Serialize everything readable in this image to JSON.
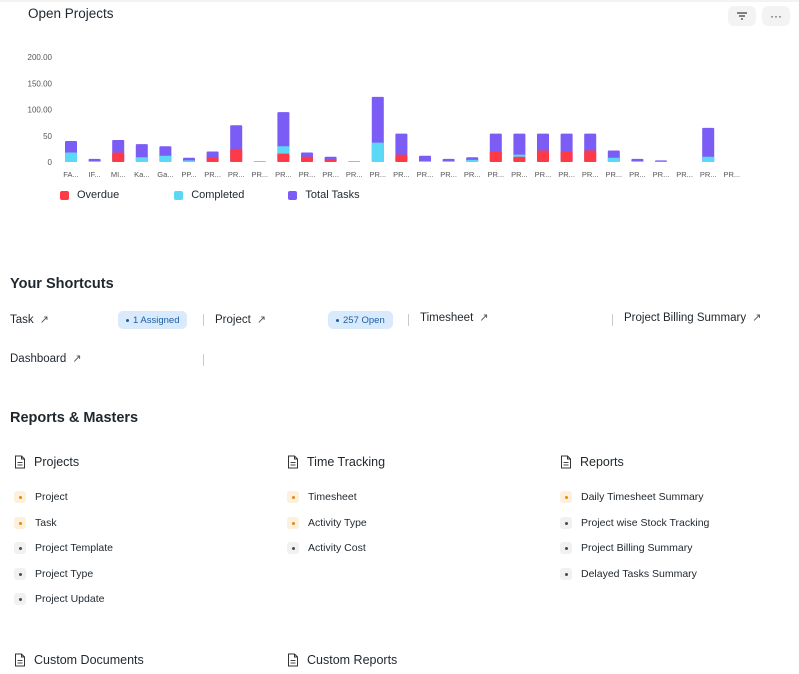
{
  "header": {
    "title": "Open Projects",
    "filter_icon": "filter-icon",
    "more_label": "···"
  },
  "chart_data": {
    "type": "bar",
    "stacked": true,
    "title": "Open Projects",
    "categories": [
      "FA...",
      "IF...",
      "MI...",
      "Ka...",
      "Ga...",
      "PP...",
      "PR...",
      "PR...",
      "PR...",
      "PR...",
      "PR...",
      "PR...",
      "PR...",
      "PR...",
      "PR...",
      "PR...",
      "PR...",
      "PR...",
      "PR...",
      "PR...",
      "PR...",
      "PR...",
      "PR...",
      "PR...",
      "PR...",
      "PR...",
      "PR...",
      "PR...",
      "PR..."
    ],
    "series": [
      {
        "name": "Overdue",
        "color": "#ff3a47",
        "values": [
          0,
          0,
          18,
          0,
          0,
          0,
          8,
          25,
          0,
          16,
          10,
          4,
          0,
          0,
          14,
          0,
          0,
          0,
          20,
          10,
          22,
          20,
          22,
          0,
          0,
          0,
          0,
          0,
          0
        ]
      },
      {
        "name": "Completed",
        "color": "#5bd8f5",
        "values": [
          18,
          2,
          5,
          9,
          12,
          3,
          4,
          8,
          2,
          30,
          4,
          2,
          2,
          37,
          10,
          2,
          2,
          4,
          5,
          14,
          5,
          6,
          5,
          8,
          2,
          1,
          0,
          10,
          0
        ]
      },
      {
        "name": "Total Tasks",
        "color": "#7b5cf5",
        "values": [
          40,
          6,
          42,
          34,
          30,
          8,
          20,
          70,
          2,
          95,
          18,
          10,
          1,
          124,
          54,
          12,
          6,
          9,
          54,
          54,
          54,
          54,
          54,
          22,
          6,
          3,
          0,
          65,
          0
        ]
      }
    ],
    "yticks": [
      "0",
      "50",
      "100.00",
      "150.00",
      "200.00"
    ],
    "ylim": [
      0,
      200
    ],
    "legend_position": "bottom-left",
    "grid": false
  },
  "legend": [
    {
      "label": "Overdue",
      "color": "#ff3a47"
    },
    {
      "label": "Completed",
      "color": "#5bd8f5"
    },
    {
      "label": "Total Tasks",
      "color": "#7b5cf5"
    }
  ],
  "shortcuts": {
    "title": "Your Shortcuts",
    "items": [
      {
        "label": "Task",
        "badge": "1 Assigned"
      },
      {
        "label": "Project",
        "badge": "257 Open"
      },
      {
        "label": "Timesheet"
      },
      {
        "label": "Project Billing Summary"
      },
      {
        "label": "Dashboard"
      }
    ]
  },
  "reports": {
    "title": "Reports & Masters",
    "cards": [
      {
        "title": "Projects",
        "links": [
          {
            "label": "Project",
            "style": "orange"
          },
          {
            "label": "Task",
            "style": "orange"
          },
          {
            "label": "Project Template",
            "style": "gray"
          },
          {
            "label": "Project Type",
            "style": "gray"
          },
          {
            "label": "Project Update",
            "style": "gray"
          }
        ]
      },
      {
        "title": "Time Tracking",
        "links": [
          {
            "label": "Timesheet",
            "style": "orange"
          },
          {
            "label": "Activity Type",
            "style": "orange"
          },
          {
            "label": "Activity Cost",
            "style": "gray"
          }
        ]
      },
      {
        "title": "Reports",
        "links": [
          {
            "label": "Daily Timesheet Summary",
            "style": "orange"
          },
          {
            "label": "Project wise Stock Tracking",
            "style": "gray"
          },
          {
            "label": "Project Billing Summary",
            "style": "gray"
          },
          {
            "label": "Delayed Tasks Summary",
            "style": "gray"
          }
        ]
      },
      {
        "title": "Custom Documents",
        "links": []
      },
      {
        "title": "Custom Reports",
        "links": []
      }
    ]
  }
}
